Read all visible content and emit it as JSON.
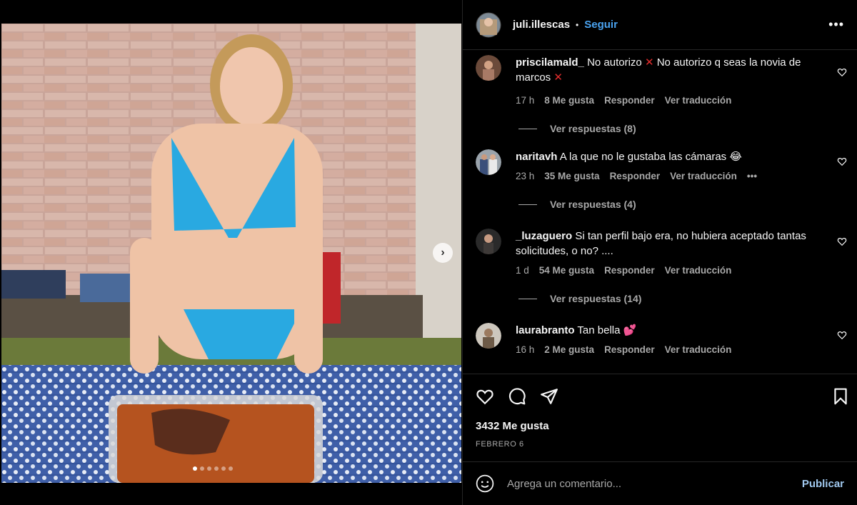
{
  "post": {
    "username": "juli.illescas",
    "separator": "•",
    "follow_label": "Seguir",
    "more_label": "•••",
    "likes": "3432 Me gusta",
    "date": "FEBRERO 6",
    "carousel_next": "›",
    "photo_dots": 6,
    "photo_active_dot": 0
  },
  "comments": [
    {
      "username": "priscilamald_",
      "text_a": "No autorizo",
      "x1": "✕",
      "text_b": "No autorizo q seas la novia de marcos",
      "x2": "✕",
      "time": "17 h",
      "likes": "8 Me gusta",
      "reply": "Responder",
      "translate": "Ver traducción",
      "replies": "Ver respuestas (8)"
    },
    {
      "username": "naritavh",
      "text": "A la que no le gustaba las cámaras 😂",
      "time": "23 h",
      "likes": "35 Me gusta",
      "reply": "Responder",
      "translate": "Ver traducción",
      "more": "•••",
      "replies": "Ver respuestas (4)"
    },
    {
      "username": "_luzaguero",
      "text": "Si tan perfil bajo era, no hubiera aceptado tantas solicitudes, o no? ....",
      "time": "1 d",
      "likes": "54 Me gusta",
      "reply": "Responder",
      "translate": "Ver traducción",
      "replies": "Ver respuestas (14)"
    },
    {
      "username": "laurabranto",
      "text": "Tan bella 💕",
      "time": "16 h",
      "likes": "2 Me gusta",
      "reply": "Responder",
      "translate": "Ver traducción"
    }
  ],
  "composer": {
    "placeholder": "Agrega un comentario...",
    "publish_label": "Publicar"
  },
  "icons": {
    "like": "heart-icon",
    "comment": "comment-icon",
    "share": "send-icon",
    "save": "bookmark-icon",
    "emoji": "emoji-icon",
    "more": "more-icon"
  },
  "colors": {
    "background": "#000000",
    "link": "#4aa3f0",
    "muted": "#a8a8a8",
    "reject": "#e02d2d"
  }
}
